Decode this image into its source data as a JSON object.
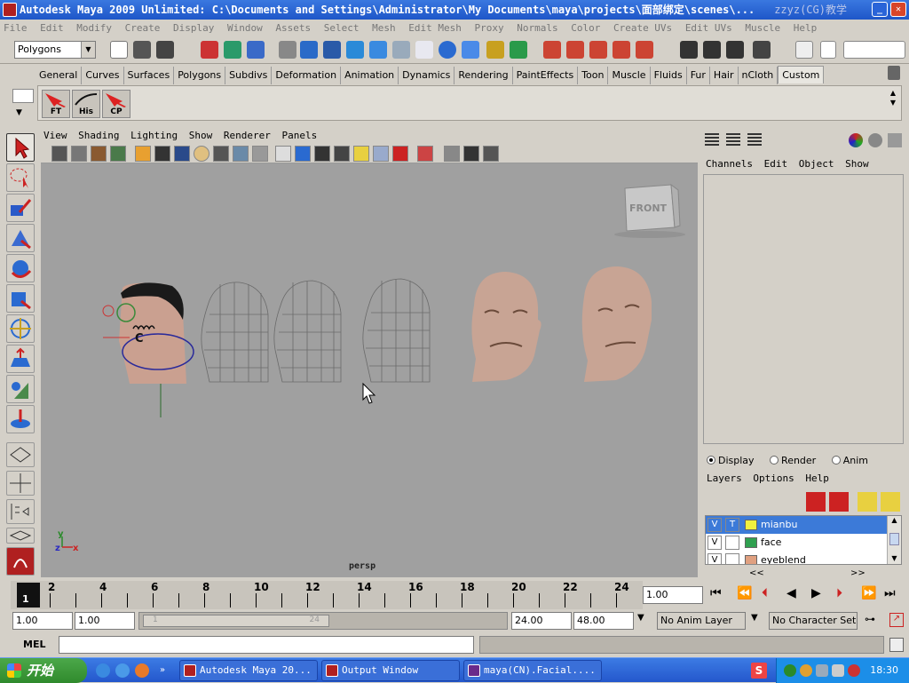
{
  "window": {
    "title": "Autodesk Maya 2009 Unlimited: C:\\Documents and Settings\\Administrator\\My Documents\\maya\\projects\\面部绑定\\scenes\\...",
    "watermark": "zzyz(CG)教学"
  },
  "menubar": [
    "File",
    "Edit",
    "Modify",
    "Create",
    "Display",
    "Window",
    "Assets",
    "Select",
    "Mesh",
    "Edit Mesh",
    "Proxy",
    "Normals",
    "Color",
    "Create UVs",
    "Edit UVs",
    "Muscle",
    "Help"
  ],
  "status": {
    "mode": "Polygons"
  },
  "shelf": {
    "tabs": [
      "General",
      "Curves",
      "Surfaces",
      "Polygons",
      "Subdivs",
      "Deformation",
      "Animation",
      "Dynamics",
      "Rendering",
      "PaintEffects",
      "Toon",
      "Muscle",
      "Fluids",
      "Fur",
      "Hair",
      "nCloth",
      "Custom"
    ],
    "active_tab": "Custom",
    "buttons": [
      {
        "label": "FT"
      },
      {
        "label": "His"
      },
      {
        "label": "CP"
      }
    ]
  },
  "panel": {
    "menu": [
      "View",
      "Shading",
      "Lighting",
      "Show",
      "Renderer",
      "Panels"
    ],
    "camera_label": "persp",
    "viewcube_label": "FRONT",
    "axis": {
      "x": "x",
      "y": "y",
      "z": "z"
    },
    "rig_label": "C"
  },
  "channelbox": {
    "menu": [
      "Channels",
      "Edit",
      "Object",
      "Show"
    ]
  },
  "layers": {
    "tabs": [
      "Display",
      "Render",
      "Anim"
    ],
    "selected_tab": "Display",
    "menu": [
      "Layers",
      "Options",
      "Help"
    ],
    "items": [
      {
        "v": "V",
        "t": "T",
        "name": "mianbu",
        "color": "#f0f040"
      },
      {
        "v": "V",
        "t": "",
        "name": "face",
        "color": "#30a050"
      },
      {
        "v": "V",
        "t": "",
        "name": "eyeblend",
        "color": "#e0a080"
      }
    ],
    "nav_prev": "<<",
    "nav_next": ">>"
  },
  "timeline": {
    "ticks": [
      "1",
      "2",
      "4",
      "6",
      "8",
      "10",
      "12",
      "14",
      "16",
      "18",
      "20",
      "22",
      "24"
    ],
    "current_frame": "1",
    "current_time": "1.00",
    "start": "1.00",
    "playback_start": "1.00",
    "range_start_label": "1",
    "range_end_label": "24",
    "playback_end": "24.00",
    "end": "48.00",
    "anim_layer": "No Anim Layer",
    "character_set": "No Character Set"
  },
  "cmdline": {
    "label": "MEL"
  },
  "taskbar": {
    "start": "开始",
    "tasks": [
      "Autodesk Maya 20...",
      "Output Window",
      "maya(CN).Facial...."
    ],
    "clock": "18:30"
  }
}
